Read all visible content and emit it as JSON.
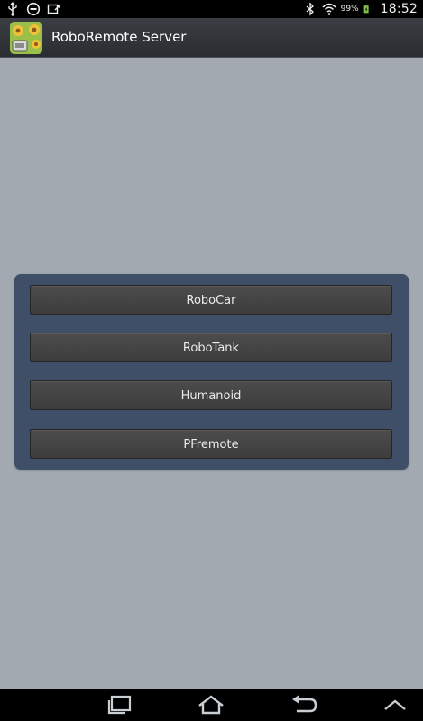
{
  "status_bar": {
    "battery_percent": "99%",
    "time": "18:52",
    "icons": [
      "usb-icon",
      "do-not-disturb-icon",
      "screenshot-icon",
      "bluetooth-icon",
      "wifi-icon",
      "battery-charging-icon"
    ]
  },
  "action_bar": {
    "title": "RoboRemote Server",
    "icon": "app-icon"
  },
  "menu": {
    "buttons": [
      {
        "label": "RoboCar"
      },
      {
        "label": "RoboTank"
      },
      {
        "label": "Humanoid"
      },
      {
        "label": "PFremote"
      }
    ]
  },
  "nav_bar": {
    "icons": [
      "recent-apps-icon",
      "home-icon",
      "back-icon",
      "menu-up-icon"
    ]
  }
}
